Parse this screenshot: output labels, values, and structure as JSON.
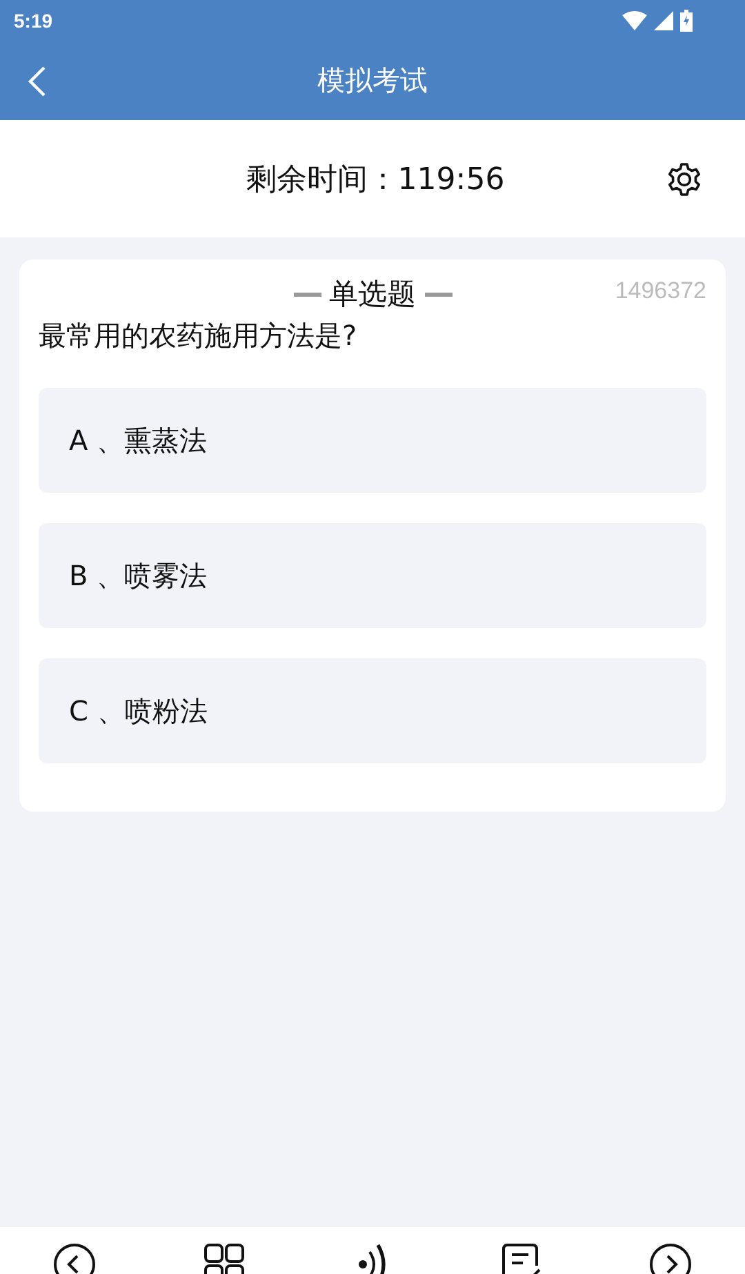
{
  "status_bar": {
    "time": "5:19"
  },
  "header": {
    "title": "模拟考试"
  },
  "timer": {
    "label": "剩余时间：119:56"
  },
  "question": {
    "type_label": "单选题",
    "number": "1496372",
    "text": "最常用的农药施用方法是?",
    "options": [
      {
        "text": "A 、熏蒸法"
      },
      {
        "text": "B 、喷雾法"
      },
      {
        "text": "C 、喷粉法"
      }
    ]
  },
  "bottom_bar": [
    {
      "kind": "prev"
    },
    {
      "kind": "grid"
    },
    {
      "kind": "audio"
    },
    {
      "kind": "submit"
    },
    {
      "kind": "next"
    }
  ]
}
